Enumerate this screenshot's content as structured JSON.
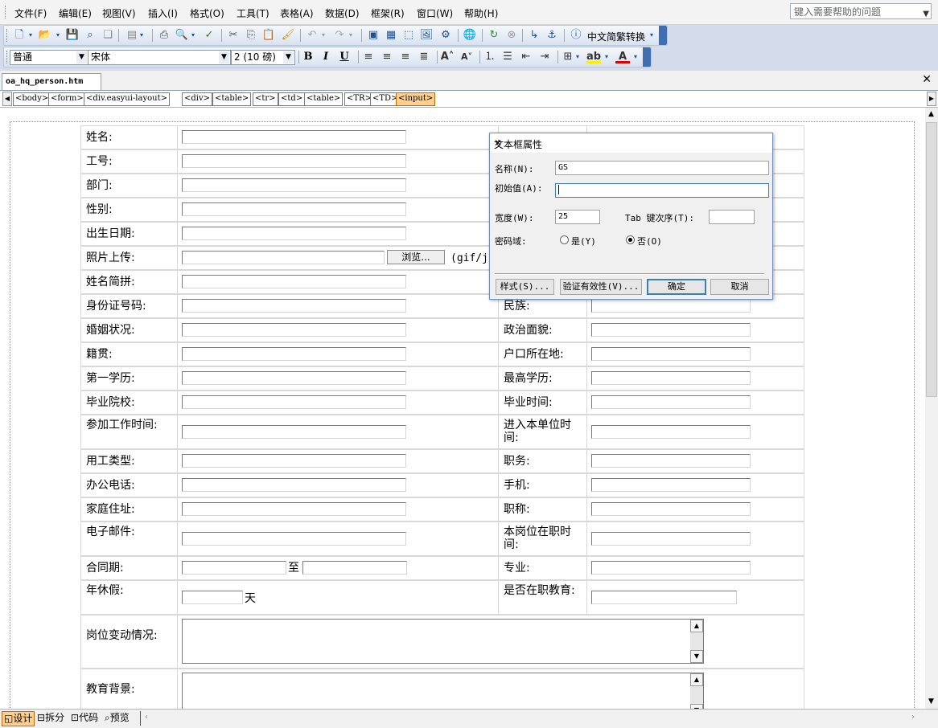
{
  "menu": [
    "文件(F)",
    "编辑(E)",
    "视图(V)",
    "插入(I)",
    "格式(O)",
    "工具(T)",
    "表格(A)",
    "数据(D)",
    "框架(R)",
    "窗口(W)",
    "帮助(H)"
  ],
  "help_placeholder": "键入需要帮助的问题",
  "toolbar": {
    "convert_label": "中文简繁转换",
    "style_value": "普通",
    "font_value": "宋体",
    "size_value": "2 (10 磅)",
    "bold_label": "B",
    "italic_label": "I",
    "underline_label": "U"
  },
  "doc_tab": "oa_hq_person.htm",
  "tags": [
    "<body>",
    "<form>",
    "<div.easyui-layout>",
    "<div>",
    "<table>",
    "<tr>",
    "<td>",
    "<table>",
    "<TR>",
    "<TD>",
    "<input>"
  ],
  "form": {
    "left_labels": [
      "姓名:",
      "工号:",
      "部门:",
      "性别:",
      "出生日期:",
      "照片上传:",
      "姓名简拼:",
      "身份证号码:",
      "婚姻状况:",
      "籍贯:",
      "第一学历:",
      "毕业院校:",
      "参加工作时间:",
      "用工类型:",
      "办公电话:",
      "家庭住址:",
      "电子邮件:",
      "合同期:",
      "年休假:",
      "岗位变动情况:",
      "教育背景:"
    ],
    "right_labels": [
      "民族:",
      "政治面貌:",
      "户口所在地:",
      "最高学历:",
      "毕业时间:",
      "进入本单位时间:",
      "职务:",
      "手机:",
      "职称:",
      "本岗位在职时间:",
      "专业:",
      "是否在职教育:"
    ],
    "browse_label": "浏览...",
    "photo_hint": "(gif/j",
    "contract_to": "至",
    "days_unit": "天"
  },
  "dialog": {
    "title": "文本框属性",
    "name_label": "名称(N):",
    "name_value": "GS",
    "initial_label": "初始值(A):",
    "initial_value": "",
    "width_label": "宽度(W):",
    "width_value": "25",
    "tab_label": "Tab 键次序(T):",
    "tab_value": "",
    "password_label": "密码域:",
    "yes_label": "是(Y)",
    "no_label": "否(O)",
    "style_button": "样式(S)...",
    "validate_button": "验证有效性(V)...",
    "ok_button": "确定",
    "cancel_button": "取消"
  },
  "view_tabs": [
    "设计",
    "拆分",
    "代码",
    "预览"
  ]
}
